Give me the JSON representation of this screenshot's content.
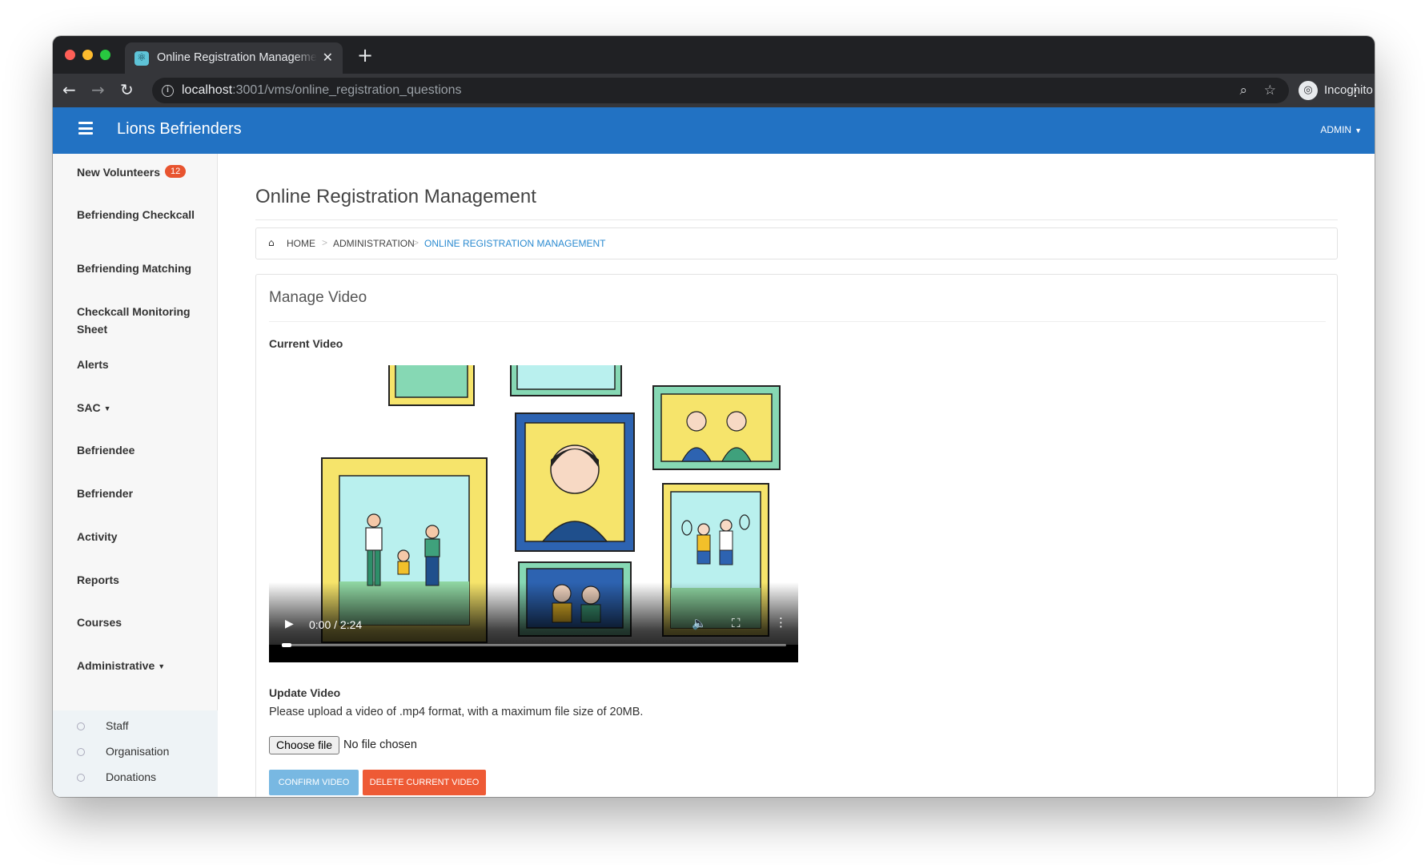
{
  "browser": {
    "tab_title": "Online Registration Management",
    "url_host": "localhost",
    "url_path": ":3001/vms/online_registration_questions",
    "profile_label": "Incognito"
  },
  "app": {
    "brand": "Lions Befrienders",
    "user_menu": "ADMIN"
  },
  "sidebar": {
    "items": [
      {
        "label": "New Volunteers",
        "badge": "12"
      },
      {
        "label": "Befriending Checkcall"
      },
      {
        "label": "Befriending Matching"
      },
      {
        "label": "Checkcall Monitoring Sheet"
      },
      {
        "label": "Alerts"
      },
      {
        "label": "SAC"
      },
      {
        "label": "Befriendee"
      },
      {
        "label": "Befriender"
      },
      {
        "label": "Activity"
      },
      {
        "label": "Reports"
      },
      {
        "label": "Courses"
      },
      {
        "label": "Administrative"
      }
    ],
    "subitems": [
      "Staff",
      "Organisation",
      "Donations"
    ]
  },
  "page": {
    "title": "Online Registration Management",
    "breadcrumb": [
      "HOME",
      "ADMINISTRATION",
      "ONLINE REGISTRATION MANAGEMENT"
    ]
  },
  "card": {
    "title": "Manage Video",
    "current_video_label": "Current Video",
    "video_time": "0:00 / 2:24",
    "update_label": "Update Video",
    "help_text": "Please upload a video of .mp4 format, with a maximum file size of 20MB.",
    "choose_file_label": "Choose file",
    "no_file_text": "No file chosen",
    "confirm_label": "CONFIRM VIDEO",
    "delete_label": "DELETE CURRENT VIDEO"
  },
  "colors": {
    "appbar": "#2272c3",
    "badge": "#e8542f",
    "confirm_button": "#78b8e2",
    "delete_button": "#ee5a35",
    "breadcrumb_active": "#2a8ad0"
  },
  "icons": [
    "react-icon",
    "close-icon",
    "plus-icon",
    "back-arrow-icon",
    "forward-arrow-icon",
    "reload-icon",
    "info-icon",
    "zoom-icon",
    "star-icon",
    "incognito-icon",
    "kebab-icon",
    "hamburger-icon",
    "home-icon",
    "play-icon",
    "volume-icon",
    "fullscreen-icon",
    "more-icon"
  ]
}
